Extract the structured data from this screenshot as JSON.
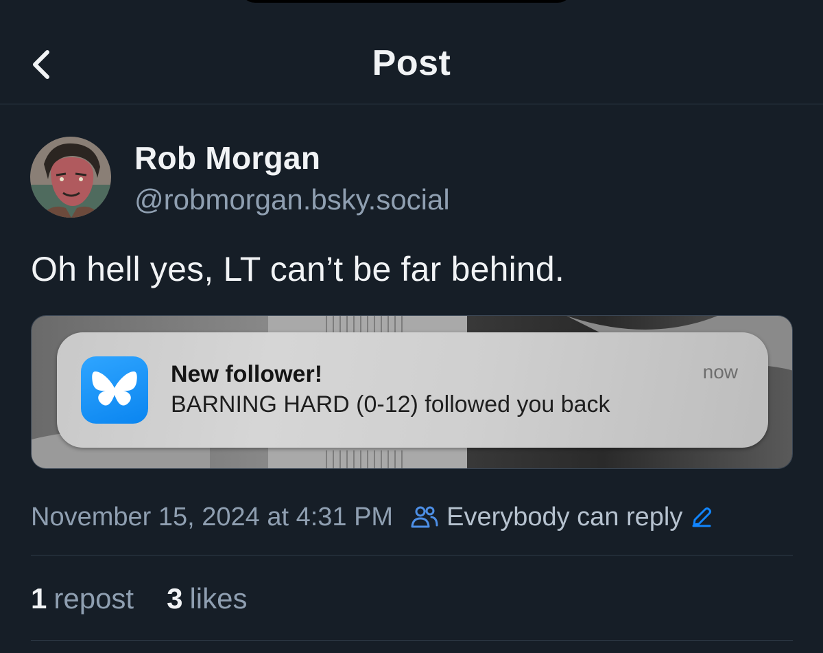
{
  "header": {
    "title": "Post",
    "back_icon": "chevron-left-icon"
  },
  "author": {
    "name": "Rob Morgan",
    "handle": "@robmorgan.bsky.social",
    "avatar_icon": "avatar-illustration"
  },
  "post": {
    "text": "Oh hell yes, LT can’t be far behind.",
    "embed": {
      "notification": {
        "app_icon": "bluesky-butterfly-icon",
        "title": "New follower!",
        "body": "BARNING HARD (0-12) followed you back",
        "time": "now"
      }
    },
    "timestamp": "November 15, 2024 at 4:31 PM",
    "reply_setting": "Everybody can reply",
    "reply_icon": "people-icon",
    "edit_icon": "pencil-icon"
  },
  "stats": {
    "reposts_count": "1",
    "reposts_label": "repost",
    "likes_count": "3",
    "likes_label": "likes"
  },
  "colors": {
    "background": "#161e27",
    "accent_blue": "#1185fe",
    "muted_text": "#8f9fb1",
    "divider": "#2e3a47"
  }
}
